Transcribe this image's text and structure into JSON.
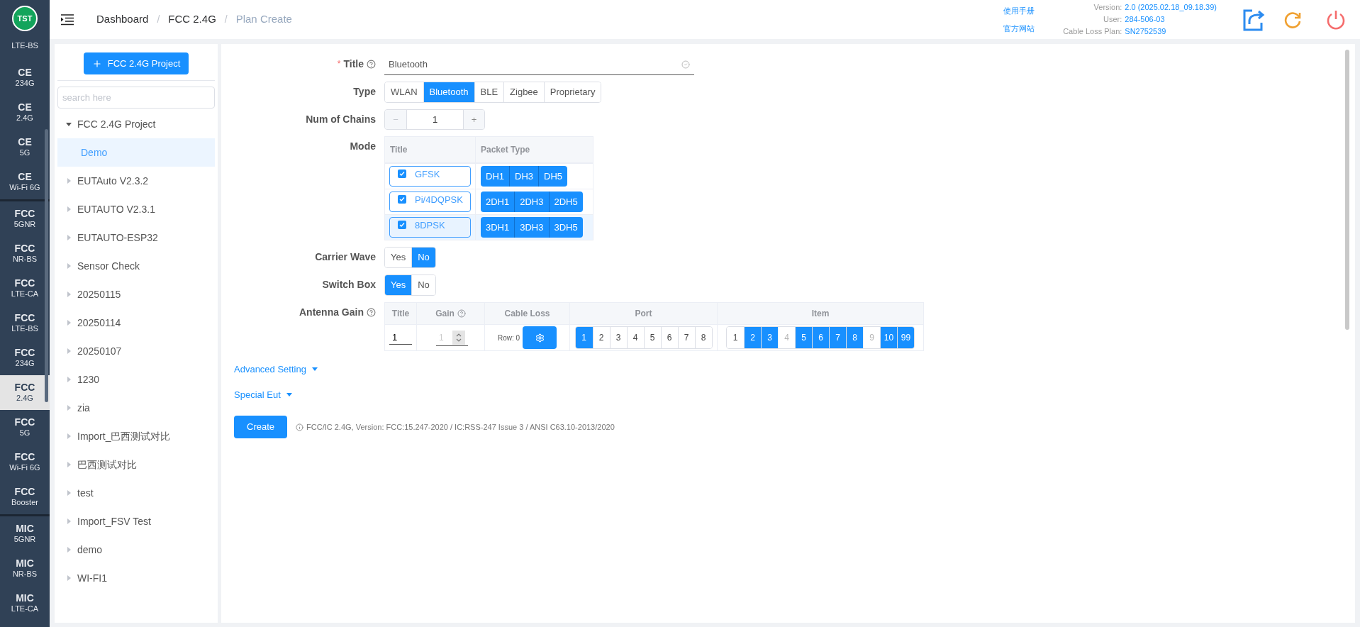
{
  "sidebar": {
    "logo": "TST",
    "groups": [
      {
        "items": [
          {
            "sub": "LTE-BS",
            "selected": false
          },
          {
            "title": "CE",
            "sub": "234G",
            "selected": false
          },
          {
            "title": "CE",
            "sub": "2.4G",
            "selected": false
          },
          {
            "title": "CE",
            "sub": "5G",
            "selected": false
          },
          {
            "title": "CE",
            "sub": "Wi-Fi 6G",
            "selected": false
          }
        ]
      },
      {
        "items": [
          {
            "title": "FCC",
            "sub": "5GNR",
            "selected": false
          },
          {
            "title": "FCC",
            "sub": "NR-BS",
            "selected": false
          },
          {
            "title": "FCC",
            "sub": "LTE-CA",
            "selected": false
          },
          {
            "title": "FCC",
            "sub": "LTE-BS",
            "selected": false
          },
          {
            "title": "FCC",
            "sub": "234G",
            "selected": false
          },
          {
            "title": "FCC",
            "sub": "2.4G",
            "selected": true
          },
          {
            "title": "FCC",
            "sub": "5G",
            "selected": false
          },
          {
            "title": "FCC",
            "sub": "Wi-Fi 6G",
            "selected": false
          },
          {
            "title": "FCC",
            "sub": "Booster",
            "selected": false
          }
        ]
      },
      {
        "items": [
          {
            "title": "MIC",
            "sub": "5GNR",
            "selected": false
          },
          {
            "title": "MIC",
            "sub": "NR-BS",
            "selected": false
          },
          {
            "title": "MIC",
            "sub": "LTE-CA",
            "selected": false
          }
        ]
      }
    ]
  },
  "header": {
    "breadcrumb": [
      {
        "label": "Dashboard",
        "current": false
      },
      {
        "separator": "/",
        "label": "FCC 2.4G",
        "current": false
      },
      {
        "separator": "/",
        "label": "Plan Create",
        "current": true
      }
    ],
    "links": [
      "使用手册",
      "官方网站"
    ],
    "info": [
      {
        "label": "Version:",
        "value": "2.0 (2025.02.18_09.18.39)"
      },
      {
        "label": "User:",
        "value": "284-506-03"
      },
      {
        "label": "Cable Loss Plan:",
        "value": "SN2752539"
      }
    ]
  },
  "tree": {
    "add_button": "FCC 2.4G Project",
    "search": {
      "placeholder": "search here"
    },
    "nodes": [
      {
        "label": "FCC 2.4G Project",
        "expanded": true,
        "selected": false,
        "children": [
          {
            "label": "Demo",
            "selected": true
          }
        ]
      },
      {
        "label": "EUTAuto V2.3.2",
        "expanded": false,
        "selected": false
      },
      {
        "label": "EUTAUTO V2.3.1",
        "expanded": false,
        "selected": false
      },
      {
        "label": "EUTAUTO-ESP32",
        "expanded": false,
        "selected": false
      },
      {
        "label": "Sensor Check",
        "expanded": false,
        "selected": false
      },
      {
        "label": "20250115",
        "expanded": false,
        "selected": false
      },
      {
        "label": "20250114",
        "expanded": false,
        "selected": false
      },
      {
        "label": "20250107",
        "expanded": false,
        "selected": false
      },
      {
        "label": "1230",
        "expanded": false,
        "selected": false
      },
      {
        "label": "zia",
        "expanded": false,
        "selected": false
      },
      {
        "label": "Import_巴西测试对比",
        "expanded": false,
        "selected": false
      },
      {
        "label": "巴西测试对比",
        "expanded": false,
        "selected": false
      },
      {
        "label": "test",
        "expanded": false,
        "selected": false
      },
      {
        "label": "Import_FSV Test",
        "expanded": false,
        "selected": false
      },
      {
        "label": "demo",
        "expanded": false,
        "selected": false
      },
      {
        "label": "WI-FI1",
        "expanded": false,
        "selected": false
      }
    ]
  },
  "form": {
    "title": {
      "label": "Title",
      "required_mark": "*",
      "value": "Bluetooth"
    },
    "type": {
      "label": "Type",
      "options": [
        {
          "label": "WLAN",
          "selected": false
        },
        {
          "label": "Bluetooth",
          "selected": true
        },
        {
          "label": "BLE",
          "selected": false
        },
        {
          "label": "Zigbee",
          "selected": false
        },
        {
          "label": "Proprietary",
          "selected": false
        }
      ]
    },
    "chains": {
      "label": "Num of Chains",
      "minus": "−",
      "value": "1",
      "plus": "+"
    },
    "mode": {
      "label": "Mode",
      "columns": [
        "Title",
        "Packet Type"
      ],
      "rows": [
        {
          "title": "GFSK",
          "checked": true,
          "highlighted": false,
          "packets": [
            "DH1",
            "DH3",
            "DH5"
          ]
        },
        {
          "title": "Pi/4DQPSK",
          "checked": true,
          "highlighted": false,
          "packets": [
            "2DH1",
            "2DH3",
            "2DH5"
          ]
        },
        {
          "title": "8DPSK",
          "checked": true,
          "highlighted": true,
          "packets": [
            "3DH1",
            "3DH3",
            "3DH5"
          ]
        }
      ]
    },
    "carrier_wave": {
      "label": "Carrier Wave",
      "options": [
        {
          "label": "Yes",
          "selected": false
        },
        {
          "label": "No",
          "selected": true
        }
      ]
    },
    "switch_box": {
      "label": "Switch Box",
      "options": [
        {
          "label": "Yes",
          "selected": true
        },
        {
          "label": "No",
          "selected": false
        }
      ]
    },
    "antenna_gain": {
      "label": "Antenna Gain",
      "columns": [
        "Title",
        "Gain",
        "Cable Loss",
        "Port",
        "Item"
      ],
      "row": {
        "title": "1",
        "gain_placeholder": "1",
        "cable_loss": "Row: 0",
        "ports": [
          {
            "label": "1",
            "selected": true
          },
          {
            "label": "2",
            "selected": false
          },
          {
            "label": "3",
            "selected": false
          },
          {
            "label": "4",
            "selected": false
          },
          {
            "label": "5",
            "selected": false
          },
          {
            "label": "6",
            "selected": false
          },
          {
            "label": "7",
            "selected": false
          },
          {
            "label": "8",
            "selected": false
          }
        ],
        "items": [
          {
            "label": "1",
            "selected": false,
            "disabled": false
          },
          {
            "label": "2",
            "selected": true,
            "disabled": false
          },
          {
            "label": "3",
            "selected": true,
            "disabled": false
          },
          {
            "label": "4",
            "selected": false,
            "disabled": true
          },
          {
            "label": "5",
            "selected": true,
            "disabled": false
          },
          {
            "label": "6",
            "selected": true,
            "disabled": false
          },
          {
            "label": "7",
            "selected": true,
            "disabled": false
          },
          {
            "label": "8",
            "selected": true,
            "disabled": false
          },
          {
            "label": "9",
            "selected": false,
            "disabled": true
          },
          {
            "label": "10",
            "selected": true,
            "disabled": false
          },
          {
            "label": "99",
            "selected": true,
            "disabled": false
          }
        ]
      }
    },
    "expanders": [
      "Advanced Setting",
      "Special Eut"
    ],
    "submit": "Create",
    "note": "FCC/IC 2.4G, Version: FCC:15.247-2020 / IC:RSS-247 Issue 3 / ANSI C63.10-2013/2020"
  }
}
